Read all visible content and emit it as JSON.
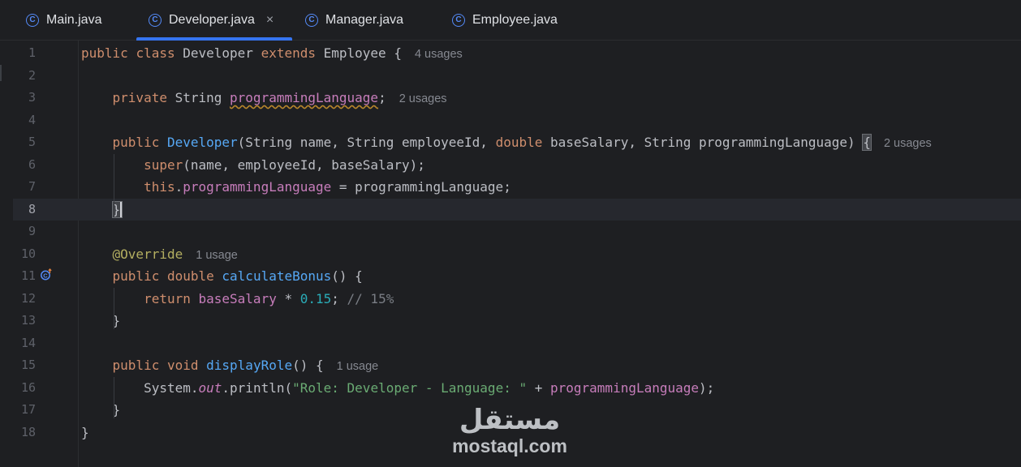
{
  "tabs": [
    {
      "label": "Main.java",
      "icon": "class-icon",
      "active": false
    },
    {
      "label": "Developer.java",
      "icon": "class-icon",
      "active": true,
      "close": "×"
    },
    {
      "label": "Manager.java",
      "icon": "class-icon",
      "active": false
    },
    {
      "label": "Employee.java",
      "icon": "class-icon",
      "active": false
    }
  ],
  "editor": {
    "current_line": 8,
    "lines": [
      {
        "n": "1",
        "tokens": [
          {
            "t": "public ",
            "c": "kw"
          },
          {
            "t": "class ",
            "c": "kw"
          },
          {
            "t": "Developer ",
            "c": ""
          },
          {
            "t": "extends ",
            "c": "kw"
          },
          {
            "t": "Employee {",
            "c": ""
          }
        ],
        "hint": "4 usages"
      },
      {
        "n": "2",
        "tokens": []
      },
      {
        "n": "3",
        "tokens": [
          {
            "t": "    private ",
            "c": "kw"
          },
          {
            "t": "String ",
            "c": ""
          },
          {
            "t": "programmingLanguage",
            "c": "fld squig"
          },
          {
            "t": ";",
            "c": ""
          }
        ],
        "hint": "2 usages"
      },
      {
        "n": "4",
        "tokens": []
      },
      {
        "n": "5",
        "tokens": [
          {
            "t": "    public ",
            "c": "kw"
          },
          {
            "t": "Developer",
            "c": "fn"
          },
          {
            "t": "(String name, String employeeId, ",
            "c": ""
          },
          {
            "t": "double ",
            "c": "kw"
          },
          {
            "t": "baseSalary, String programmingLanguage) ",
            "c": ""
          },
          {
            "t": "{",
            "c": "bracehl"
          }
        ],
        "hint": "2 usages"
      },
      {
        "n": "6",
        "tokens": [
          {
            "t": "        super",
            "c": "kw"
          },
          {
            "t": "(name, employeeId, baseSalary);",
            "c": ""
          }
        ]
      },
      {
        "n": "7",
        "tokens": [
          {
            "t": "        this",
            "c": "kw"
          },
          {
            "t": ".",
            "c": ""
          },
          {
            "t": "programmingLanguage",
            "c": "fld"
          },
          {
            "t": " = programmingLanguage;",
            "c": ""
          }
        ]
      },
      {
        "n": "8",
        "tokens": [
          {
            "t": "    ",
            "c": ""
          },
          {
            "t": "}",
            "c": "bracehl caret"
          }
        ]
      },
      {
        "n": "9",
        "tokens": []
      },
      {
        "n": "10",
        "tokens": [
          {
            "t": "    @Override",
            "c": "ann"
          }
        ],
        "hint": "1 usage"
      },
      {
        "n": "11",
        "tokens": [
          {
            "t": "    public ",
            "c": "kw"
          },
          {
            "t": "double ",
            "c": "kw"
          },
          {
            "t": "calculateBonus",
            "c": "fn"
          },
          {
            "t": "() {",
            "c": ""
          }
        ]
      },
      {
        "n": "12",
        "tokens": [
          {
            "t": "        return ",
            "c": "kw"
          },
          {
            "t": "baseSalary",
            "c": "fld"
          },
          {
            "t": " * ",
            "c": ""
          },
          {
            "t": "0.15",
            "c": "num"
          },
          {
            "t": "; ",
            "c": ""
          },
          {
            "t": "// 15%",
            "c": "cmt"
          }
        ]
      },
      {
        "n": "13",
        "tokens": [
          {
            "t": "    }",
            "c": ""
          }
        ]
      },
      {
        "n": "14",
        "tokens": []
      },
      {
        "n": "15",
        "tokens": [
          {
            "t": "    public ",
            "c": "kw"
          },
          {
            "t": "void ",
            "c": "kw"
          },
          {
            "t": "displayRole",
            "c": "fn"
          },
          {
            "t": "() {",
            "c": ""
          }
        ],
        "hint": "1 usage"
      },
      {
        "n": "16",
        "tokens": [
          {
            "t": "        System.",
            "c": ""
          },
          {
            "t": "out",
            "c": "fld ital"
          },
          {
            "t": ".println(",
            "c": ""
          },
          {
            "t": "\"Role: Developer - Language: \"",
            "c": "str"
          },
          {
            "t": " + ",
            "c": ""
          },
          {
            "t": "programmingLanguage",
            "c": "fld"
          },
          {
            "t": ");",
            "c": ""
          }
        ]
      },
      {
        "n": "17",
        "tokens": [
          {
            "t": "    }",
            "c": ""
          }
        ]
      },
      {
        "n": "18",
        "tokens": [
          {
            "t": "}",
            "c": ""
          }
        ]
      }
    ]
  },
  "gutter_icons": {
    "line_11": "override-icon"
  },
  "watermark": {
    "arabic": "مستقل",
    "latin": "mostaql.com"
  },
  "colors": {
    "keyword": "#cf8e6d",
    "method": "#56a8f5",
    "field": "#c77dbb",
    "string": "#6aab73",
    "number": "#2aacb8",
    "comment": "#7a7e85",
    "annotation": "#b3ae60",
    "accent": "#3574f0"
  }
}
